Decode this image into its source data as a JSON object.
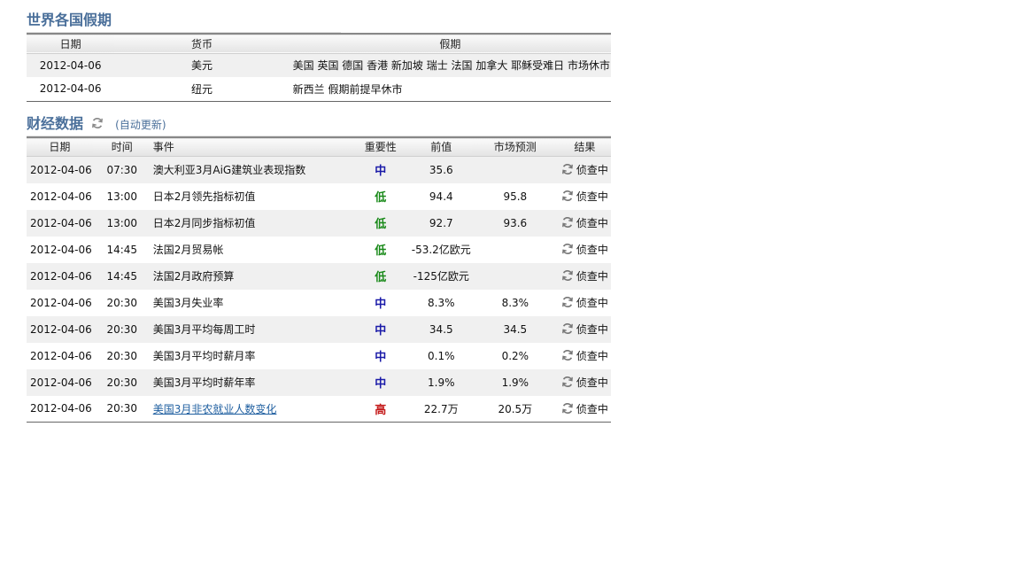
{
  "holidays": {
    "title": "世界各国假期",
    "headers": [
      "日期",
      "货币",
      "假期"
    ],
    "rows": [
      {
        "date": "2012-04-06",
        "currency": "美元",
        "holiday": "美国 英国 德国 香港 新加坡 瑞士 法国 加拿大 耶稣受难日 市场休市"
      },
      {
        "date": "2012-04-06",
        "currency": "纽元",
        "holiday": "新西兰 假期前提早休市"
      }
    ]
  },
  "finance": {
    "title": "财经数据",
    "auto_update": "(自动更新)",
    "refresh_icon": "refresh-icon",
    "headers": [
      "日期",
      "时间",
      "事件",
      "重要性",
      "前值",
      "市场预测",
      "结果"
    ],
    "rows": [
      {
        "date": "2012-04-06",
        "time": "07:30",
        "event": "澳大利亚3月AiG建筑业表现指数",
        "importance": "中",
        "level": "mid",
        "prev": "35.6",
        "forecast": "",
        "result": "侦查中"
      },
      {
        "date": "2012-04-06",
        "time": "13:00",
        "event": "日本2月领先指标初值",
        "importance": "低",
        "level": "low",
        "prev": "94.4",
        "forecast": "95.8",
        "result": "侦查中"
      },
      {
        "date": "2012-04-06",
        "time": "13:00",
        "event": "日本2月同步指标初值",
        "importance": "低",
        "level": "low",
        "prev": "92.7",
        "forecast": "93.6",
        "result": "侦查中"
      },
      {
        "date": "2012-04-06",
        "time": "14:45",
        "event": "法国2月贸易帐",
        "importance": "低",
        "level": "low",
        "prev": "-53.2亿欧元",
        "forecast": "",
        "result": "侦查中"
      },
      {
        "date": "2012-04-06",
        "time": "14:45",
        "event": "法国2月政府预算",
        "importance": "低",
        "level": "low",
        "prev": "-125亿欧元",
        "forecast": "",
        "result": "侦查中"
      },
      {
        "date": "2012-04-06",
        "time": "20:30",
        "event": "美国3月失业率",
        "importance": "中",
        "level": "mid",
        "prev": "8.3%",
        "forecast": "8.3%",
        "result": "侦查中"
      },
      {
        "date": "2012-04-06",
        "time": "20:30",
        "event": "美国3月平均每周工时",
        "importance": "中",
        "level": "mid",
        "prev": "34.5",
        "forecast": "34.5",
        "result": "侦查中"
      },
      {
        "date": "2012-04-06",
        "time": "20:30",
        "event": "美国3月平均时薪月率",
        "importance": "中",
        "level": "mid",
        "prev": "0.1%",
        "forecast": "0.2%",
        "result": "侦查中"
      },
      {
        "date": "2012-04-06",
        "time": "20:30",
        "event": "美国3月平均时薪年率",
        "importance": "中",
        "level": "mid",
        "prev": "1.9%",
        "forecast": "1.9%",
        "result": "侦查中"
      },
      {
        "date": "2012-04-06",
        "time": "20:30",
        "event": "美国3月非农就业人数变化",
        "importance": "高",
        "level": "high",
        "prev": "22.7万",
        "forecast": "20.5万",
        "result": "侦查中",
        "link": true
      }
    ]
  },
  "colors": {
    "title": "#4a6f9a",
    "mid": "#1a1aa8",
    "low": "#1a8a1a",
    "high": "#c41a1a",
    "link": "#1f5fa0"
  }
}
